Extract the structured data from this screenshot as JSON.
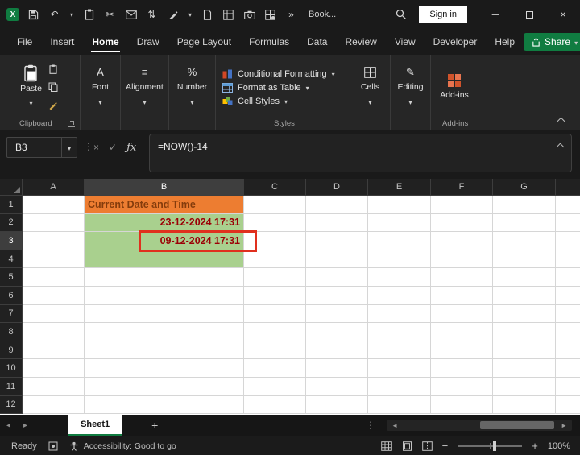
{
  "icons": {
    "logo": "X",
    "undo": "↶",
    "caret": "▾",
    "cut": "✂",
    "sort_arrows": "⇅",
    "chevrons": "»",
    "dots": "⋮",
    "cancel": "×",
    "check": "✓",
    "fx": "ƒx",
    "minimize": "─",
    "close": "×",
    "font_a": "A",
    "align_lines": "≡",
    "percent": "%",
    "pencil": "✎",
    "prev_sheet": "◂",
    "next_sheet": "▸",
    "scroll_left": "◄",
    "scroll_right": "►",
    "add_sheet": "+",
    "zoom_out": "−",
    "zoom_in": "+"
  },
  "titlebar": {
    "workbook_name": "Book...",
    "signin_label": "Sign in"
  },
  "menubar": {
    "items": [
      "File",
      "Insert",
      "Home",
      "Draw",
      "Page Layout",
      "Formulas",
      "Data",
      "Review",
      "View",
      "Developer",
      "Help"
    ],
    "active_item": "Home",
    "share_label": "Share"
  },
  "ribbon": {
    "paste_label": "Paste",
    "font_label": "Font",
    "alignment_label": "Alignment",
    "number_label": "Number",
    "styles_items": [
      "Conditional Formatting",
      "Format as Table",
      "Cell Styles"
    ],
    "cells_label": "Cells",
    "editing_label": "Editing",
    "addins_label": "Add-ins",
    "group_labels": {
      "clipboard": "Clipboard",
      "styles": "Styles",
      "addins": "Add-ins"
    }
  },
  "formula_bar": {
    "name_box": "B3",
    "formula": "=NOW()-14"
  },
  "grid": {
    "columns": [
      "A",
      "B",
      "C",
      "D",
      "E",
      "F",
      "G"
    ],
    "rows": [
      "1",
      "2",
      "3",
      "4",
      "5",
      "6",
      "7",
      "8",
      "9",
      "10",
      "11",
      "12"
    ],
    "selected_column": "B",
    "selected_row": "3",
    "cells": {
      "B1": {
        "text": "Current Date and Time",
        "style": "title"
      },
      "B2": {
        "text": "23-12-2024 17:31",
        "style": "date"
      },
      "B3": {
        "text": "09-12-2024 17:31",
        "style": "date",
        "annotated": true
      },
      "B4": {
        "text": "",
        "style": "date"
      }
    },
    "colors": {
      "title_bg": "#ED7D31",
      "title_text": "#843C0C",
      "date_bg": "#A9D08E",
      "date_text": "#9C0006",
      "annotation": "#E0301E",
      "header_selected_bg": "#3E3E3E",
      "header_selected_text": "#ffffff"
    }
  },
  "sheet_bar": {
    "tabs": [
      {
        "label": "Sheet1",
        "active": true
      }
    ]
  },
  "status_bar": {
    "ready_label": "Ready",
    "accessibility_label": "Accessibility: Good to go",
    "zoom_level": "100%"
  }
}
